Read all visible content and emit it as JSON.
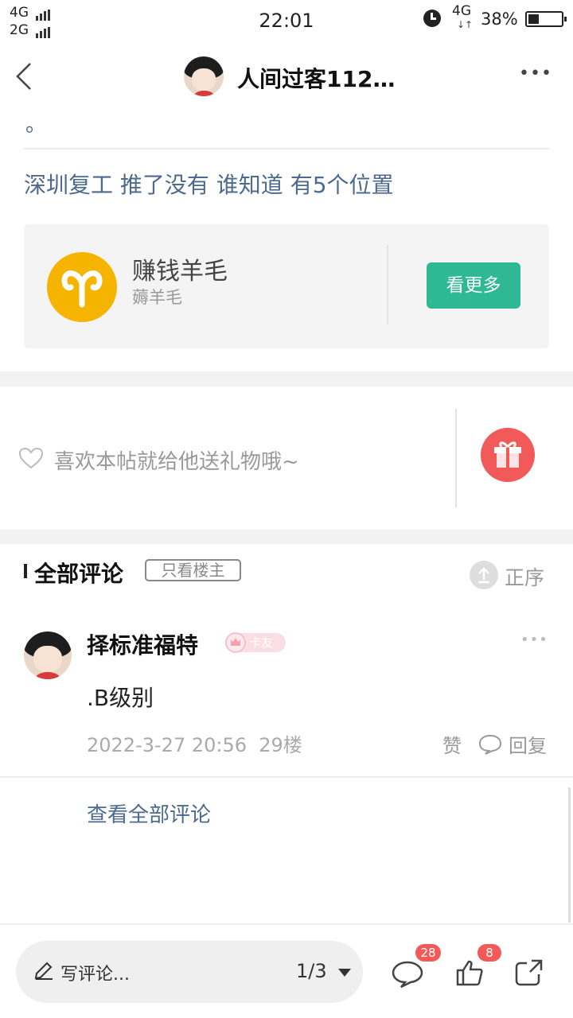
{
  "status_bar": {
    "net1": "4G",
    "net2": "2G",
    "time": "22:01",
    "net_right": "4G",
    "battery": "38%"
  },
  "header": {
    "title": "人间过客112…",
    "more": "•••"
  },
  "post": {
    "tail_punct": "。",
    "body": "深圳复工 推了没有 谁知道 有5个位置"
  },
  "circle_card": {
    "name": "赚钱羊毛",
    "sub": "薅羊毛",
    "button": "看更多"
  },
  "gift": {
    "text": "喜欢本帖就给他送礼物哦~"
  },
  "comments": {
    "title": "全部评论",
    "filter": "只看楼主",
    "sort": "正序",
    "items": [
      {
        "user": "择标准福特",
        "badge": "卡友",
        "text": ".B级别",
        "meta": "2022-3-27 20:56  29楼",
        "like": "赞",
        "reply": "回复"
      }
    ],
    "view_all": "查看全部评论"
  },
  "bottom_bar": {
    "write": "写评论...",
    "page": "1/3",
    "comment_count": "28",
    "like_count": "8"
  },
  "colors": {
    "link": "#4b6a8e",
    "green_button": "#2fb894",
    "gift_red": "#f25a5a",
    "circle_yellow": "#f5b400",
    "badge_red": "#f25a5a"
  }
}
